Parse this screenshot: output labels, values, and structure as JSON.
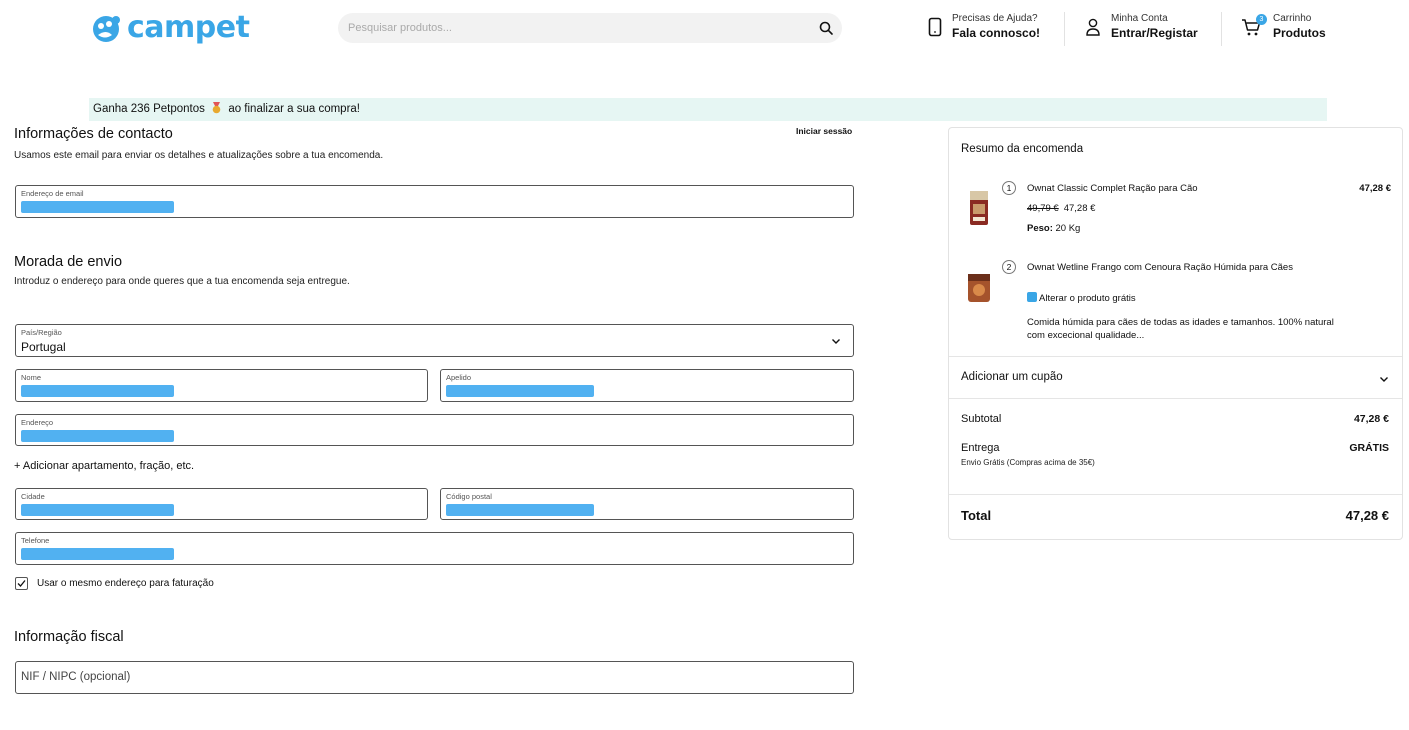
{
  "header": {
    "logo_text": "campet",
    "search_placeholder": "Pesquisar produtos...",
    "help_small": "Precisas de Ajuda?",
    "help_big": "Fala connosco!",
    "account_small": "Minha Conta",
    "account_big": "Entrar/Registar",
    "cart_small": "Carrinho",
    "cart_big": "Produtos",
    "cart_count": "3",
    "brand_color": "#3aa6e6"
  },
  "promo": {
    "text_before": "Ganha 236 Petpontos",
    "icon": "medal-icon",
    "text_after": "ao finalizar a sua compra!"
  },
  "contact": {
    "title": "Informações de contacto",
    "subtitle": "Usamos este email para enviar os detalhes e atualizações sobre a tua encomenda.",
    "login_link": "Iniciar sessão",
    "email_label": "Endereço de email"
  },
  "shipping": {
    "title": "Morada de envio",
    "subtitle": "Introduz o endereço para onde queres que a tua encomenda seja entregue.",
    "country_label": "País/Região",
    "country_value": "Portugal",
    "first_name_label": "Nome",
    "last_name_label": "Apelido",
    "address_label": "Endereço",
    "add_apartment": "+ Adicionar apartamento, fração, etc.",
    "city_label": "Cidade",
    "postal_label": "Código postal",
    "phone_label": "Telefone",
    "same_billing": "Usar o mesmo endereço para faturação"
  },
  "fiscal": {
    "title": "Informação fiscal",
    "nif_placeholder": "NIF / NIPC (opcional)"
  },
  "summary": {
    "title": "Resumo da encomenda",
    "items": [
      {
        "qty": "1",
        "name": "Ownat Classic Complet Ração para Cão",
        "price": "47,28 €",
        "old_price": "49,79 €",
        "new_price": "47,28 €",
        "weight_label": "Peso:",
        "weight_value": "20 Kg"
      },
      {
        "qty": "2",
        "name": "Ownat Wetline Frango com Cenoura Ração Húmida para Cães",
        "gift_text": "Alterar o produto grátis",
        "desc_line1": "Comida húmida para cães de todas as idades e tamanhos. 100% natural",
        "desc_line2": "com excecional qualidade..."
      }
    ],
    "coupon": "Adicionar um cupão",
    "subtotal_label": "Subtotal",
    "subtotal_value": "47,28 €",
    "delivery_label": "Entrega",
    "delivery_value": "GRÁTIS",
    "delivery_note": "Envio Grátis (Compras acima de 35€)",
    "total_label": "Total",
    "total_value": "47,28 €"
  }
}
